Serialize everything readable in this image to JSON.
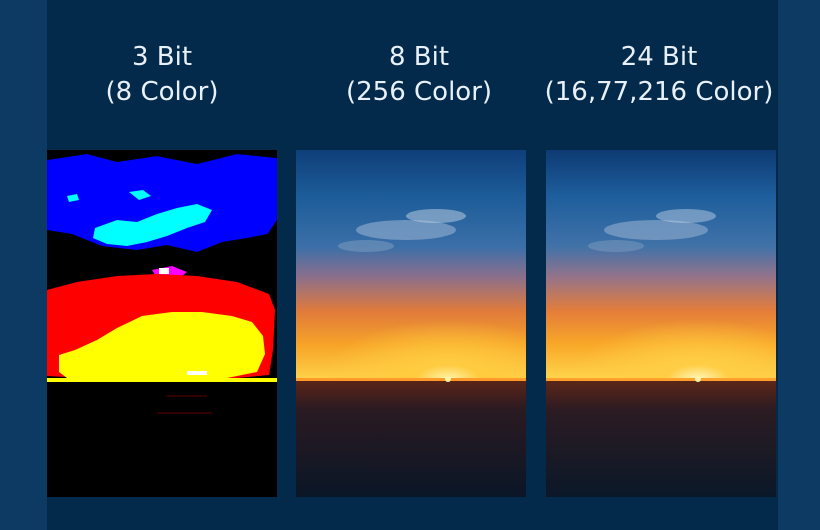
{
  "panels": [
    {
      "title_line1": "3 Bit",
      "title_line2": "(8 Color)"
    },
    {
      "title_line1": "8 Bit",
      "title_line2": "(256 Color)"
    },
    {
      "title_line1": "24 Bit",
      "title_line2": "(16,77,216 Color)"
    }
  ],
  "colors": {
    "outer_background": "#0c3a63",
    "panel_background": "#032a4b",
    "label_text": "#e9f1f8"
  }
}
